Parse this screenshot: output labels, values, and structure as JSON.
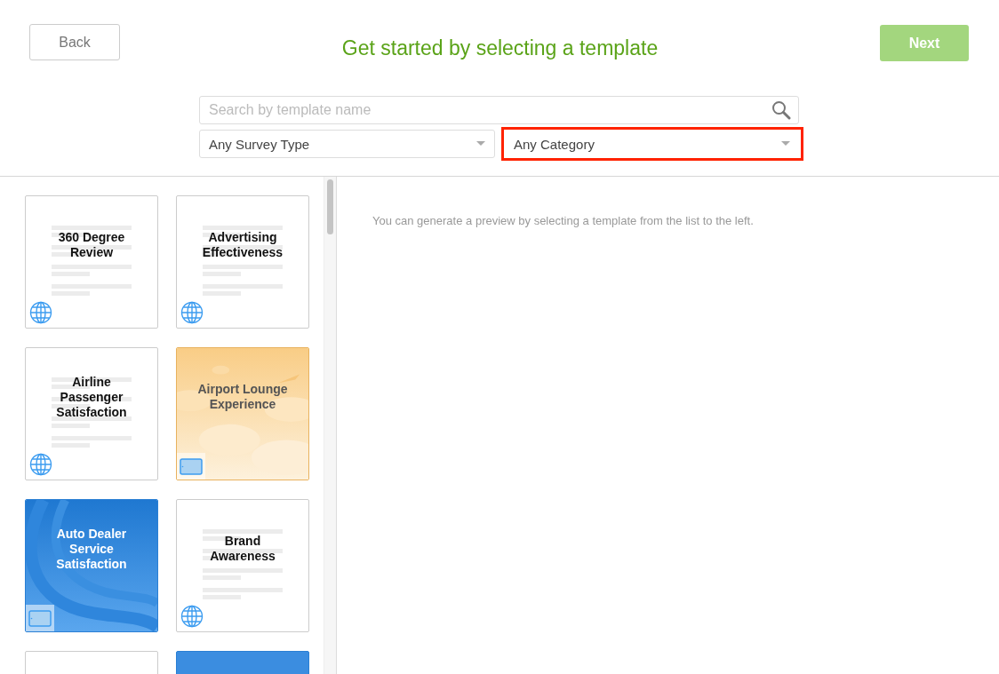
{
  "header": {
    "back": "Back",
    "title": "Get started by selecting a template",
    "next": "Next",
    "next_disabled": true
  },
  "search": {
    "placeholder": "Search by template name"
  },
  "filters": [
    {
      "value": "Any Survey Type",
      "highlighted": false
    },
    {
      "value": "Any Category",
      "highlighted": true
    }
  ],
  "templates": [
    {
      "title": "360 Degree Review",
      "kind": "plain",
      "tablet": false
    },
    {
      "title": "Advertising Effectiveness",
      "kind": "plain",
      "tablet": false
    },
    {
      "title": "Airline Passenger Satisfaction",
      "kind": "plain",
      "tablet": false
    },
    {
      "title": "Airport Lounge Experience",
      "kind": "sky",
      "tablet": true
    },
    {
      "title": "Auto Dealer Service Satisfaction",
      "kind": "road",
      "tablet": true
    },
    {
      "title": "Brand Awareness",
      "kind": "plain",
      "tablet": false
    },
    {
      "kind": "plain"
    },
    {
      "kind": "blue"
    }
  ],
  "preview": {
    "message": "You can generate a preview by selecting a template from the list to the left."
  }
}
